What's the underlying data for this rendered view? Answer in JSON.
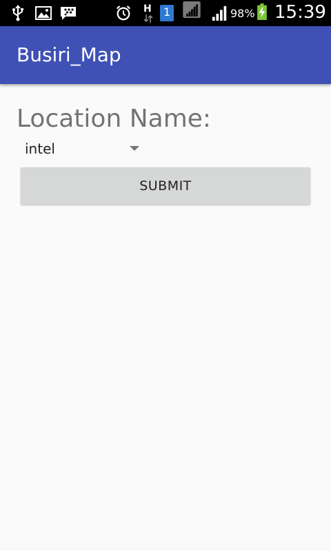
{
  "status_bar": {
    "battery_percent": "98%",
    "time": "15:39",
    "sim_slot": "1",
    "network_label": "H",
    "icons": [
      "usb-icon",
      "gallery-icon",
      "bbm-icon",
      "alarm-icon",
      "hspa-data-icon",
      "sim-1-icon",
      "signal-1-icon",
      "signal-2-icon",
      "battery-charging-icon"
    ]
  },
  "app_bar": {
    "title": "Busiri_Map",
    "color": "#3f51b5"
  },
  "form": {
    "location_label": "Location Name:",
    "location_selected": "intel",
    "submit_label": "SUBMIT"
  }
}
